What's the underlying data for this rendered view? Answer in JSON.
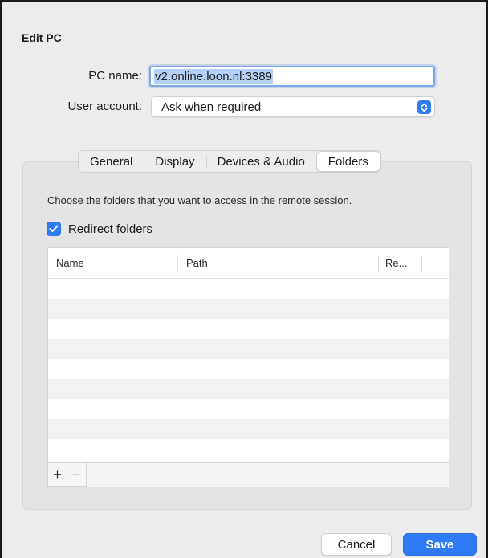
{
  "dialog": {
    "title": "Edit PC"
  },
  "pc_name": {
    "label": "PC name:",
    "value": "v2.online.loon.nl:3389"
  },
  "user_account": {
    "label": "User account:",
    "selected": "Ask when required"
  },
  "tabs": [
    {
      "label": "General",
      "active": false
    },
    {
      "label": "Display",
      "active": false
    },
    {
      "label": "Devices & Audio",
      "active": false
    },
    {
      "label": "Folders",
      "active": true
    }
  ],
  "folders": {
    "description": "Choose the folders that you want to access in the remote session.",
    "redirect_label": "Redirect folders",
    "redirect_checked": true,
    "columns": [
      "Name",
      "Path",
      "Re..."
    ],
    "rows": []
  },
  "toolbar": {
    "add_label": "+",
    "remove_label": "−"
  },
  "buttons": {
    "cancel": "Cancel",
    "save": "Save"
  },
  "colors": {
    "accent": "#2f7bf6",
    "selection": "#b3d1f7"
  }
}
